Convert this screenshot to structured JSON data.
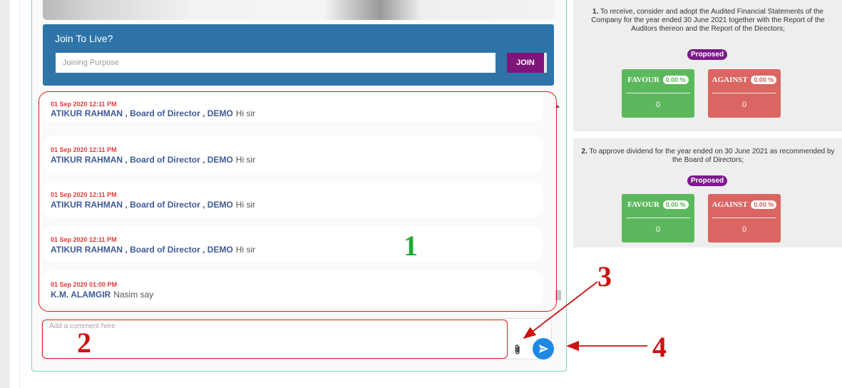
{
  "join": {
    "title": "Join To Live?",
    "placeholder": "Joining Purpose",
    "button": "JOIN"
  },
  "messages": [
    {
      "time": "01 Sep 2020 12:11 PM",
      "author": "ATIKUR RAHMAN , Board of Director , DEMO",
      "text": "Hi sir"
    },
    {
      "time": "01 Sep 2020 12:11 PM",
      "author": "ATIKUR RAHMAN , Board of Director , DEMO",
      "text": "Hi sir"
    },
    {
      "time": "01 Sep 2020 12:11 PM",
      "author": "ATIKUR RAHMAN , Board of Director , DEMO",
      "text": "Hi sir"
    },
    {
      "time": "01 Sep 2020 12:11 PM",
      "author": "ATIKUR RAHMAN , Board of Director , DEMO",
      "text": "Hi sir"
    },
    {
      "time": "01 Sep 2020 01:00 PM",
      "author": "K.M. ALAMGIR",
      "text": "Nasim say"
    }
  ],
  "comment": {
    "placeholder": "Add a comment here"
  },
  "icons": {
    "attach": "paperclip-icon",
    "send": "send-icon"
  },
  "annotations": {
    "labels": [
      "1",
      "2",
      "3",
      "4"
    ],
    "colors": {
      "rect": "#e01b1b",
      "label_1": "#1faa36",
      "label_other": "#cc1111"
    }
  },
  "agenda": [
    {
      "number": "1.",
      "text": "To receive, consider and adopt the Audited Financial Statements of the Company for the year ended 30 June 2021 together with the Report of the Auditors thereon and the Report of the Directors;",
      "status": "Proposed",
      "favour": {
        "label": "FAVOUR",
        "percent": "0.00 %",
        "count": "0"
      },
      "against": {
        "label": "AGAINST",
        "percent": "0.00 %",
        "count": "0"
      }
    },
    {
      "number": "2.",
      "text": "To approve dividend for the year ended on 30 June 2021 as recommended by the Board of Directors;",
      "status": "Proposed",
      "favour": {
        "label": "FAVOUR",
        "percent": "0.00 %",
        "count": "0"
      },
      "against": {
        "label": "AGAINST",
        "percent": "0.00 %",
        "count": "0"
      }
    }
  ],
  "colors": {
    "join_bg": "#2e74a8",
    "join_button": "#7e157a",
    "time": "#e23a3a",
    "author": "#3e5a9a",
    "favour": "#5cb85c",
    "against": "#d9534f",
    "badge": "#7b1a8a",
    "send": "#1e88e5"
  }
}
